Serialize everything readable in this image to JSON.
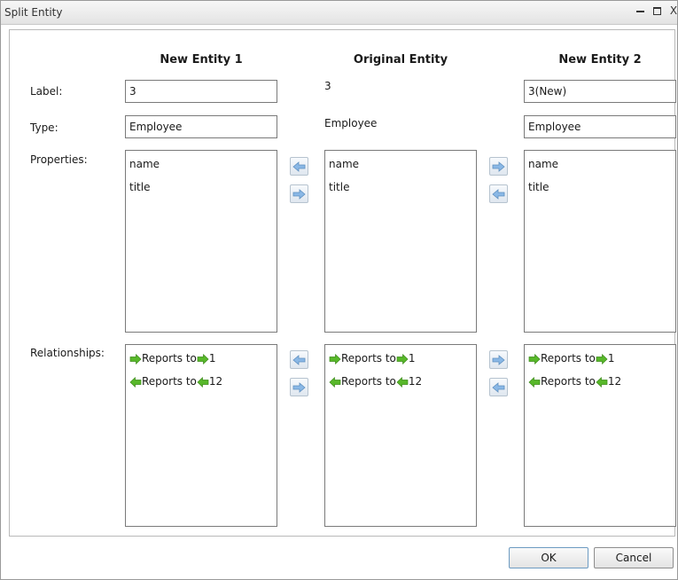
{
  "window": {
    "title": "Split Entity",
    "min_glyph": "",
    "max_glyph": "",
    "close_glyph": "X"
  },
  "columns": {
    "new1": "New Entity 1",
    "original": "Original Entity",
    "new2": "New Entity 2"
  },
  "rows": {
    "label": "Label:",
    "type": "Type:",
    "properties": "Properties:",
    "relationships": "Relationships:"
  },
  "new_entity_1": {
    "label_value": "3",
    "type_value": "Employee",
    "properties": [
      "name",
      "title"
    ],
    "relationships": [
      {
        "direction": "out",
        "text": "Reports to",
        "target": "1"
      },
      {
        "direction": "in",
        "text": "Reports to",
        "target": "12"
      }
    ]
  },
  "original_entity": {
    "label_value": "3",
    "type_value": "Employee",
    "properties": [
      "name",
      "title"
    ],
    "relationships": [
      {
        "direction": "out",
        "text": "Reports to",
        "target": "1"
      },
      {
        "direction": "in",
        "text": "Reports to",
        "target": "12"
      }
    ]
  },
  "new_entity_2": {
    "label_value": "3(New)",
    "type_value": "Employee",
    "properties": [
      "name",
      "title"
    ],
    "relationships": [
      {
        "direction": "out",
        "text": "Reports to",
        "target": "1"
      },
      {
        "direction": "in",
        "text": "Reports to",
        "target": "12"
      }
    ]
  },
  "buttons": {
    "ok": "OK",
    "cancel": "Cancel"
  },
  "colors": {
    "relation_arrow_green": "#58b82a",
    "move_arrow_blue": "#8ab8e6"
  }
}
